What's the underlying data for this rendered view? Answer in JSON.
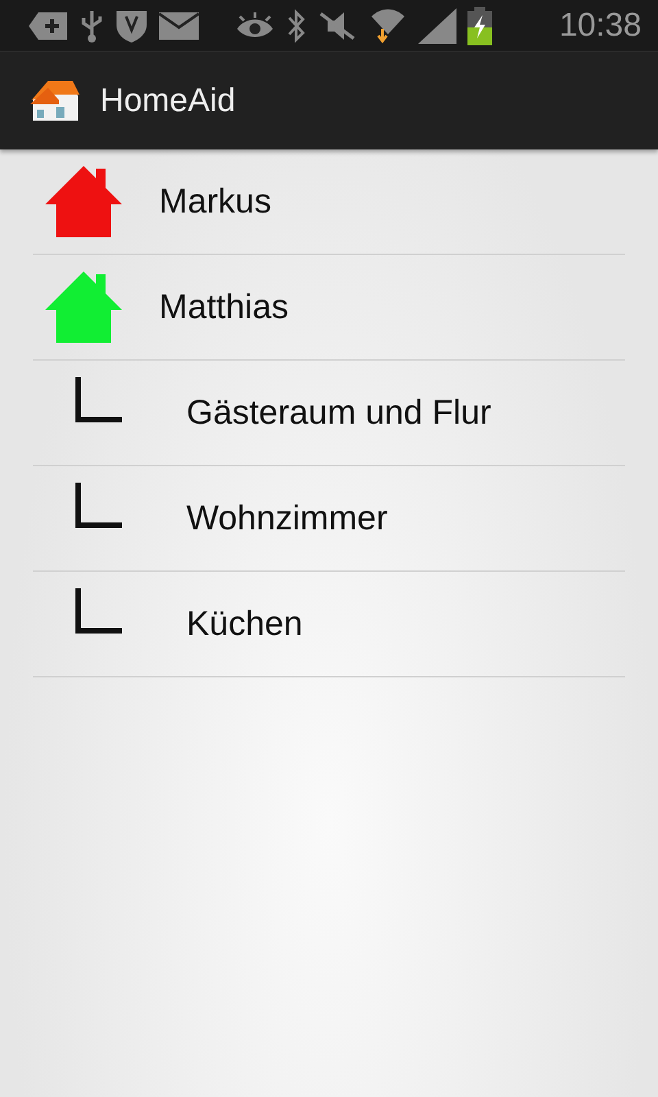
{
  "status_bar": {
    "time": "10:38"
  },
  "app_bar": {
    "title": "HomeAid"
  },
  "tree": [
    {
      "label": "Markus",
      "color": "#ee1111"
    },
    {
      "label": "Matthias",
      "color": "#11ee33",
      "children": [
        {
          "label": "Gästeraum und Flur"
        },
        {
          "label": "Wohnzimmer"
        },
        {
          "label": "Küchen"
        }
      ]
    }
  ]
}
